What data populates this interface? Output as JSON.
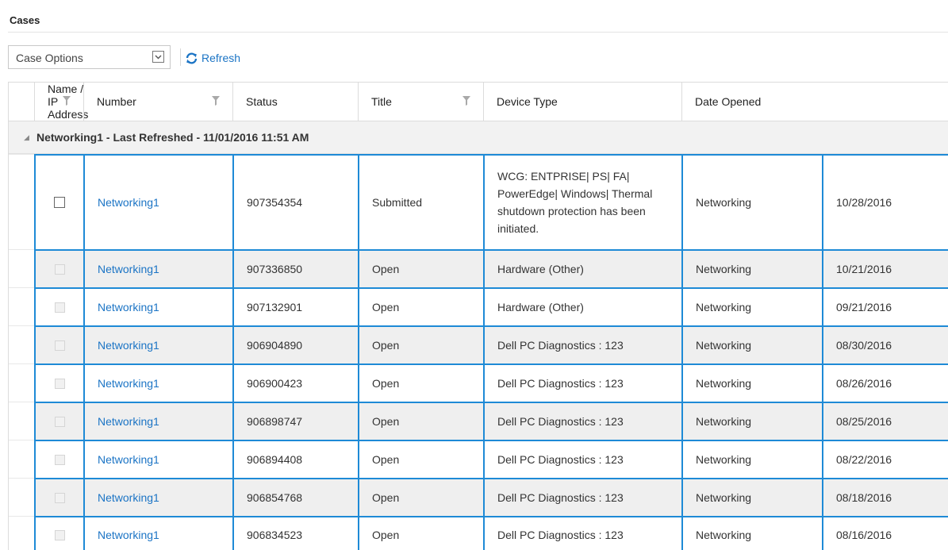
{
  "page": {
    "title": "Cases"
  },
  "toolbar": {
    "case_options_label": "Case Options",
    "refresh_label": "Refresh",
    "accent_color": "#1b74c5"
  },
  "table": {
    "columns": [
      {
        "key": "select",
        "label": ""
      },
      {
        "key": "name",
        "label": "Name / IP Address",
        "filterable": true
      },
      {
        "key": "number",
        "label": "Number",
        "filterable": true
      },
      {
        "key": "status",
        "label": "Status",
        "filterable": false
      },
      {
        "key": "title",
        "label": "Title",
        "filterable": true
      },
      {
        "key": "device_type",
        "label": "Device Type",
        "filterable": false
      },
      {
        "key": "date_opened",
        "label": "Date Opened",
        "filterable": false
      }
    ],
    "group_label": "Networking1 - Last Refreshed - 11/01/2016 11:51 AM",
    "rows": [
      {
        "name": "Networking1",
        "number": "907354354",
        "status": "Submitted",
        "title": "WCG: ENTPRISE| PS| FA| PowerEdge| Windows| Thermal shutdown protection has been initiated.",
        "device_type": "Networking",
        "date_opened": "10/28/2016"
      },
      {
        "name": "Networking1",
        "number": "907336850",
        "status": "Open",
        "title": "Hardware (Other)",
        "device_type": "Networking",
        "date_opened": "10/21/2016"
      },
      {
        "name": "Networking1",
        "number": "907132901",
        "status": "Open",
        "title": "Hardware (Other)",
        "device_type": "Networking",
        "date_opened": "09/21/2016"
      },
      {
        "name": "Networking1",
        "number": "906904890",
        "status": "Open",
        "title": "Dell PC Diagnostics : 123",
        "device_type": "Networking",
        "date_opened": "08/30/2016"
      },
      {
        "name": "Networking1",
        "number": "906900423",
        "status": "Open",
        "title": "Dell PC Diagnostics : 123",
        "device_type": "Networking",
        "date_opened": "08/26/2016"
      },
      {
        "name": "Networking1",
        "number": "906898747",
        "status": "Open",
        "title": "Dell PC Diagnostics : 123",
        "device_type": "Networking",
        "date_opened": "08/25/2016"
      },
      {
        "name": "Networking1",
        "number": "906894408",
        "status": "Open",
        "title": "Dell PC Diagnostics : 123",
        "device_type": "Networking",
        "date_opened": "08/22/2016"
      },
      {
        "name": "Networking1",
        "number": "906854768",
        "status": "Open",
        "title": "Dell PC Diagnostics : 123",
        "device_type": "Networking",
        "date_opened": "08/18/2016"
      },
      {
        "name": "Networking1",
        "number": "906834523",
        "status": "Open",
        "title": "Dell PC Diagnostics : 123",
        "device_type": "Networking",
        "date_opened": "08/16/2016"
      }
    ]
  },
  "colors": {
    "row_selection_border": "#1e8ad6",
    "link": "#1b74c5",
    "alt_row": "#efefef",
    "group_row": "#f2f2f2"
  }
}
